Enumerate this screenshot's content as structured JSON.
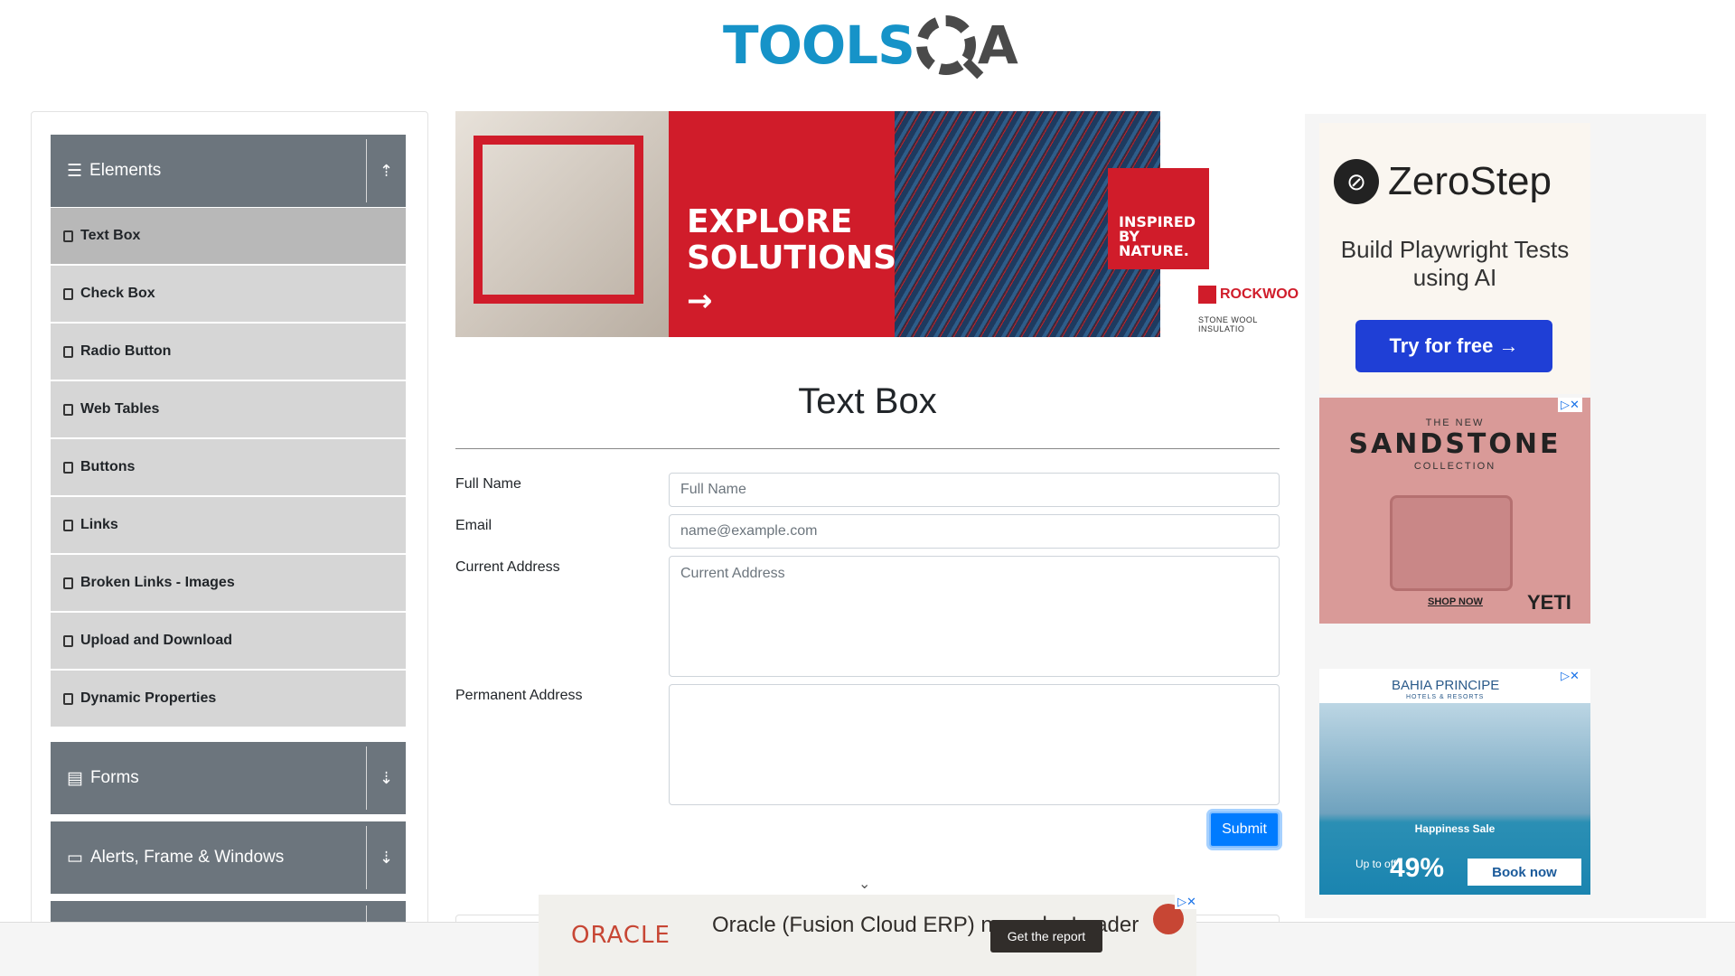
{
  "header": {
    "logo_tools": "TOOLS",
    "logo_qa": "A"
  },
  "sidebar": {
    "elements_label": "Elements",
    "items": [
      {
        "label": "Text Box"
      },
      {
        "label": "Check Box"
      },
      {
        "label": "Radio Button"
      },
      {
        "label": "Web Tables"
      },
      {
        "label": "Buttons"
      },
      {
        "label": "Links"
      },
      {
        "label": "Broken Links - Images"
      },
      {
        "label": "Upload and Download"
      },
      {
        "label": "Dynamic Properties"
      }
    ],
    "forms_label": "Forms",
    "alerts_label": "Alerts, Frame & Windows"
  },
  "banner": {
    "headline": "EXPLORE SOLUTIONS",
    "arrow": "→",
    "inspired": "INSPIRED BY NATURE.",
    "brand": "ROCKWOO",
    "brand_sub": "STONE WOOL INSULATIO"
  },
  "main": {
    "title": "Text Box",
    "full_name_label": "Full Name",
    "full_name_placeholder": "Full Name",
    "email_label": "Email",
    "email_placeholder": "name@example.com",
    "current_address_label": "Current Address",
    "current_address_placeholder": "Current Address",
    "permanent_address_label": "Permanent Address",
    "submit_label": "Submit"
  },
  "ads": {
    "zerostep": {
      "brand": "ZeroStep",
      "tagline": "Build Playwright Tests using AI",
      "button": "Try for free →"
    },
    "yeti": {
      "the_new": "THE NEW",
      "title": "SANDSTONE",
      "collection": "COLLECTION",
      "shop": "SHOP NOW",
      "brand": "YETI"
    },
    "bahia": {
      "brand": "BAHIA PRINCIPE",
      "sub": "HOTELS & RESORTS",
      "sale": "Happiness Sale",
      "upto": "Up to off",
      "pct": "49%",
      "book": "Book now"
    },
    "oracle": {
      "logo": "ORACLE",
      "text": "Oracle (Fusion Cloud ERP) named a Leader",
      "button": "Get the report"
    }
  },
  "colors": {
    "accent": "#007bff",
    "sidebar_header": "#6c757d",
    "brand_blue": "#1693c8"
  }
}
